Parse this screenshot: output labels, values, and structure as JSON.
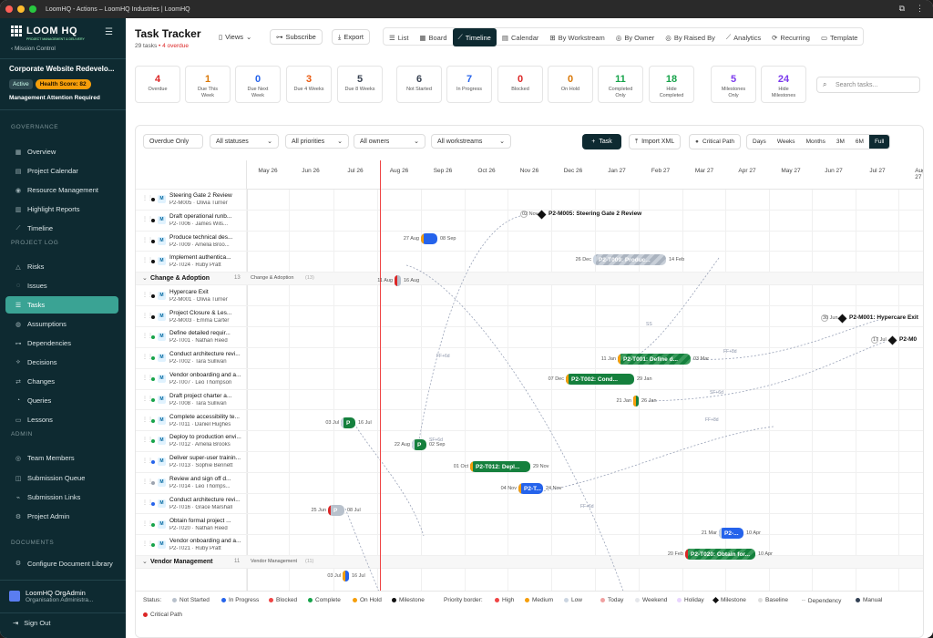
{
  "window": {
    "title": "LoomHQ - Actions – LoomHQ Industries | LoomHQ"
  },
  "sidebar": {
    "brand": "LOOM HQ",
    "tagline": "PROJECT MANAGEMENT & DELIVERY",
    "mission_control": "Mission Control",
    "project_name": "Corporate Website Redevelo...",
    "status": "Active",
    "health": "Health Score: 82",
    "attention": "Management Attention Required",
    "sections": {
      "governance": "GOVERNANCE",
      "log": "PROJECT LOG",
      "admin": "ADMIN",
      "documents": "DOCUMENTS"
    },
    "items": [
      {
        "label": "Overview",
        "icon": "▦"
      },
      {
        "label": "Project Calendar",
        "icon": "▤"
      },
      {
        "label": "Resource Management",
        "icon": "◉"
      },
      {
        "label": "Highlight Reports",
        "icon": "▥"
      },
      {
        "label": "Timeline",
        "icon": "⟋"
      },
      {
        "label": "Risks",
        "icon": "△"
      },
      {
        "label": "Issues",
        "icon": "◌"
      },
      {
        "label": "Tasks",
        "icon": "☰"
      },
      {
        "label": "Assumptions",
        "icon": "◍"
      },
      {
        "label": "Dependencies",
        "icon": "⊶"
      },
      {
        "label": "Decisions",
        "icon": "⟡"
      },
      {
        "label": "Changes",
        "icon": "⇄"
      },
      {
        "label": "Queries",
        "icon": "◔"
      },
      {
        "label": "Lessons",
        "icon": "▭"
      },
      {
        "label": "Team Members",
        "icon": "◎"
      },
      {
        "label": "Submission Queue",
        "icon": "◫"
      },
      {
        "label": "Submission Links",
        "icon": "⌁"
      },
      {
        "label": "Project Admin",
        "icon": "⚙"
      },
      {
        "label": "Configure Document Library",
        "icon": "⚙"
      }
    ],
    "user": {
      "name": "LoomHQ OrgAdmin",
      "role": "Organisation Administra..."
    },
    "signout": "Sign Out"
  },
  "header": {
    "title": "Task Tracker",
    "count": "29 tasks",
    "overdue": "• 4 overdue",
    "views": "Views",
    "subscribe": "Subscribe",
    "export": "Export",
    "tabs": [
      "List",
      "Board",
      "Timeline",
      "Calendar",
      "By Workstream",
      "By Owner",
      "By Raised By",
      "Analytics",
      "Recurring",
      "Template"
    ],
    "tab_icons": [
      "☰",
      "▦",
      "⟋",
      "▤",
      "⊞",
      "◎",
      "◎",
      "⟋",
      "⟳",
      "▭"
    ]
  },
  "stats": [
    {
      "num": "4",
      "label": "Overdue",
      "color": "#dc2626"
    },
    {
      "num": "1",
      "label": "Due This Week",
      "color": "#d97706"
    },
    {
      "num": "0",
      "label": "Due Next Week",
      "color": "#2563eb"
    },
    {
      "num": "3",
      "label": "Due 4 Weeks",
      "color": "#ea580c"
    },
    {
      "num": "5",
      "label": "Due 8 Weeks",
      "color": "#374151"
    },
    {
      "num": "6",
      "label": "Not Started",
      "color": "#374151"
    },
    {
      "num": "7",
      "label": "In Progress",
      "color": "#2563eb"
    },
    {
      "num": "0",
      "label": "Blocked",
      "color": "#dc2626"
    },
    {
      "num": "0",
      "label": "On Hold",
      "color": "#d97706"
    },
    {
      "num": "11",
      "label": "Completed Only",
      "color": "#16a34a"
    },
    {
      "num": "18",
      "label": "Hide Completed",
      "color": "#16a34a"
    },
    {
      "num": "5",
      "label": "Milestones Only",
      "color": "#7c3aed"
    },
    {
      "num": "24",
      "label": "Hide Milestones",
      "color": "#7c3aed"
    }
  ],
  "search_placeholder": "Search tasks...",
  "filters": [
    "Overdue Only",
    "All statuses",
    "All priorities",
    "All owners",
    "All workstreams"
  ],
  "actions": {
    "task": "Task",
    "import": "Import XML",
    "critical": "Critical Path"
  },
  "zoom": [
    "Days",
    "Weeks",
    "Months",
    "3M",
    "6M",
    "Full"
  ],
  "months": [
    "May 26",
    "Jun 26",
    "Jul 26",
    "Aug 26",
    "Sep 26",
    "Oct 26",
    "Nov 26",
    "Dec 26",
    "Jan 27",
    "Feb 27",
    "Mar 27",
    "Apr 27",
    "May 27",
    "Jun 27",
    "Jul 27",
    "Aug 27"
  ],
  "rows": [
    {
      "name": "Steering Gate 2 Review",
      "sub": "P2-M005 · Olivia Turner",
      "dot": ""
    },
    {
      "name": "Draft operational runb...",
      "sub": "P2-T006 · James Wils...",
      "dot": ""
    },
    {
      "name": "Produce technical des...",
      "sub": "P2-T009 · Amelia Broo...",
      "dot": ""
    },
    {
      "name": "Implement authentica...",
      "sub": "P2-T024 · Ruby Pratt",
      "dot": ""
    },
    {
      "group": "Change & Adoption",
      "count": "13",
      "gtag": "Change & Adoption",
      "gtcount": "(13)"
    },
    {
      "name": "Hypercare Exit",
      "sub": "P2-M001 · Olivia Turner",
      "dot": ""
    },
    {
      "name": "Project Closure & Les...",
      "sub": "P2-M003 · Emma Carter",
      "dot": ""
    },
    {
      "name": "Define detailed requir...",
      "sub": "P2-T001 · Nathan Reed",
      "dot": "g"
    },
    {
      "name": "Conduct architecture revi...",
      "sub": "P2-T002 · Tara Sullivan",
      "dot": "g"
    },
    {
      "name": "Vendor onboarding and a...",
      "sub": "P2-T007 · Leo Thompson",
      "dot": "g"
    },
    {
      "name": "Draft project charter a...",
      "sub": "P2-T008 · Tara Sullivan",
      "dot": "g"
    },
    {
      "name": "Complete accessibility te...",
      "sub": "P2-T011 · Daniel Hughes",
      "dot": "g"
    },
    {
      "name": "Deploy to production envi...",
      "sub": "P2-T012 · Amelia Brooks",
      "dot": "g"
    },
    {
      "name": "Deliver super-user trainin...",
      "sub": "P2-T013 · Sophie Bennett",
      "dot": "b"
    },
    {
      "name": "Review and sign off d...",
      "sub": "P2-T014 · Leo Thomps...",
      "dot": "gr"
    },
    {
      "name": "Conduct architecture revi...",
      "sub": "P2-T016 · Grace Marshall",
      "dot": "b"
    },
    {
      "name": "Obtain formal project ...",
      "sub": "P2-T020 · Nathan Reed",
      "dot": "g"
    },
    {
      "name": "Vendor onboarding and a...",
      "sub": "P2-T021 · Ruby Pratt",
      "dot": "g"
    },
    {
      "group": "Vendor Management",
      "count": "11",
      "gtag": "Vendor Management",
      "gtcount": "(11)"
    }
  ],
  "bars": [
    {
      "label": "",
      "start": "27 Aug",
      "end": "08 Sep",
      "kind": "blue",
      "pri": "#f59e0b"
    },
    {
      "label": "P2-T009: Produc...",
      "start": "26 Dec",
      "end": "14 Feb",
      "kind": "hgrey",
      "pri": "#cbd5e1"
    },
    {
      "label": "",
      "start": "11 Aug",
      "end": "16 Aug",
      "kind": "grey",
      "pri": "#dc2626"
    },
    {
      "label": "P2-T001: Define d...",
      "start": "11 Jan",
      "end": "03 Mar",
      "kind": "hatch",
      "pri": "#f59e0b"
    },
    {
      "label": "P2-T002: Cond...",
      "start": "07 Dec",
      "end": "29 Jan",
      "kind": "green",
      "pri": "#f59e0b"
    },
    {
      "label": "",
      "start": "21 Jan",
      "end": "26 Jan",
      "kind": "green",
      "pri": "#f59e0b"
    },
    {
      "label": "P",
      "start": "03 Jul",
      "end": "16 Jul",
      "kind": "green",
      "pri": "#cbd5e1"
    },
    {
      "label": "P",
      "start": "22 Aug",
      "end": "02 Sep",
      "kind": "green",
      "pri": "#cbd5e1"
    },
    {
      "label": "P2-T012: Depl...",
      "start": "01 Oct",
      "end": "29 Nov",
      "kind": "green",
      "pri": "#f59e0b"
    },
    {
      "label": "P2-T...",
      "start": "04 Nov",
      "end": "24 Nov",
      "kind": "blue",
      "pri": "#f59e0b"
    },
    {
      "label": "P",
      "start": "25 Jun",
      "end": "08 Jul",
      "kind": "grey",
      "pri": "#dc2626"
    },
    {
      "label": "P2-...",
      "start": "21 Mar",
      "end": "10 Apr",
      "kind": "blue",
      "pri": "#cbd5e1"
    },
    {
      "label": "P2-T020: Obtain for...",
      "start": "20 Feb",
      "end": "10 Apr",
      "kind": "hatch",
      "pri": "#dc2626"
    },
    {
      "label": "",
      "start": "03 Jul",
      "end": "16 Jul",
      "kind": "blue",
      "pri": "#f59e0b"
    }
  ],
  "milestones": [
    {
      "label": "P2-M005: Steering Gate 2 Review",
      "date": "02 Nov"
    },
    {
      "label": "P2-M001: Hypercare Exit",
      "date": "30 Jun"
    },
    {
      "label": "P2-M0",
      "date": "17 Jul"
    }
  ],
  "dep_labels": [
    "SS",
    "FF+6d",
    "FF+8d",
    "SF+6d",
    "FF+8d",
    "SF+6d",
    "FF+6d"
  ],
  "legend": {
    "status": "Status:",
    "not_started": "Not Started",
    "in_progress": "In Progress",
    "blocked": "Blocked",
    "complete": "Complete",
    "on_hold": "On Hold",
    "milestone": "Milestone",
    "priority": "Priority border:",
    "high": "High",
    "medium": "Medium",
    "low": "Low",
    "today": "Today",
    "weekend": "Weekend",
    "holiday": "Holiday",
    "milestone2": "Milestone",
    "baseline": "Baseline",
    "dependency": "Dependency",
    "manual": "Manual",
    "critical": "Critical Path"
  }
}
